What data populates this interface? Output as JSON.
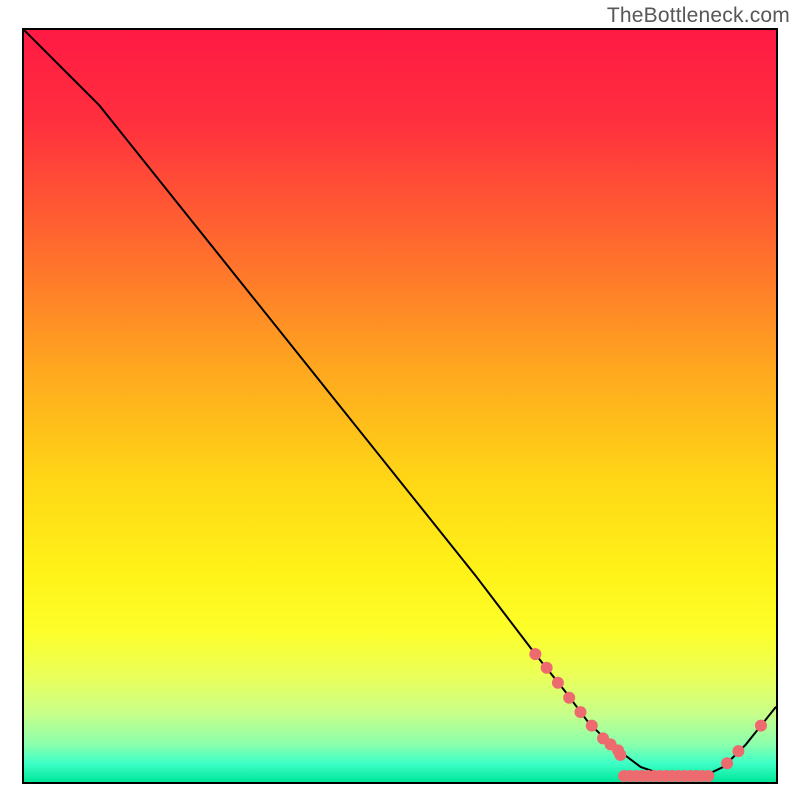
{
  "attribution": "TheBottleneck.com",
  "chart_data": {
    "type": "line",
    "title": "",
    "xlabel": "",
    "ylabel": "",
    "xlim": [
      0,
      100
    ],
    "ylim": [
      0,
      100
    ],
    "background_gradient": {
      "stops": [
        {
          "offset": 0.0,
          "color": "#ff1a44"
        },
        {
          "offset": 0.12,
          "color": "#ff2f3e"
        },
        {
          "offset": 0.3,
          "color": "#ff6f2d"
        },
        {
          "offset": 0.45,
          "color": "#ffa71f"
        },
        {
          "offset": 0.6,
          "color": "#ffd716"
        },
        {
          "offset": 0.72,
          "color": "#fff218"
        },
        {
          "offset": 0.8,
          "color": "#fdff2a"
        },
        {
          "offset": 0.86,
          "color": "#eaff5a"
        },
        {
          "offset": 0.91,
          "color": "#c7ff8a"
        },
        {
          "offset": 0.95,
          "color": "#8affac"
        },
        {
          "offset": 0.975,
          "color": "#3effc6"
        },
        {
          "offset": 1.0,
          "color": "#00e69a"
        }
      ]
    },
    "series": [
      {
        "name": "bottleneck-curve",
        "color": "#000000",
        "x": [
          0,
          6,
          10,
          20,
          30,
          40,
          50,
          60,
          68,
          72,
          75,
          78,
          82,
          86,
          90,
          93,
          96,
          100
        ],
        "y": [
          100,
          94,
          90,
          77.5,
          65,
          52.5,
          40,
          27.5,
          17,
          12,
          8,
          5,
          2,
          0.6,
          0.6,
          2,
          5,
          10
        ]
      }
    ],
    "scatter": [
      {
        "name": "markers",
        "color": "#ed6a6f",
        "radius": 6,
        "points": [
          {
            "x": 68.0,
            "y": 17.0
          },
          {
            "x": 69.5,
            "y": 15.2
          },
          {
            "x": 71.0,
            "y": 13.2
          },
          {
            "x": 72.5,
            "y": 11.2
          },
          {
            "x": 74.0,
            "y": 9.3
          },
          {
            "x": 75.5,
            "y": 7.5
          },
          {
            "x": 77.0,
            "y": 5.8
          },
          {
            "x": 78.0,
            "y": 5.0
          },
          {
            "x": 79.0,
            "y": 4.2
          },
          {
            "x": 79.3,
            "y": 3.6
          },
          {
            "x": 79.8,
            "y": 0.8
          },
          {
            "x": 80.6,
            "y": 0.8
          },
          {
            "x": 81.4,
            "y": 0.8
          },
          {
            "x": 82.2,
            "y": 0.8
          },
          {
            "x": 83.0,
            "y": 0.8
          },
          {
            "x": 83.8,
            "y": 0.8
          },
          {
            "x": 84.6,
            "y": 0.8
          },
          {
            "x": 85.4,
            "y": 0.8
          },
          {
            "x": 86.2,
            "y": 0.8
          },
          {
            "x": 87.0,
            "y": 0.8
          },
          {
            "x": 87.8,
            "y": 0.8
          },
          {
            "x": 88.6,
            "y": 0.8
          },
          {
            "x": 89.4,
            "y": 0.8
          },
          {
            "x": 90.2,
            "y": 0.8
          },
          {
            "x": 91.0,
            "y": 0.8
          },
          {
            "x": 93.5,
            "y": 2.5
          },
          {
            "x": 95.0,
            "y": 4.1
          },
          {
            "x": 98.0,
            "y": 7.5
          }
        ]
      }
    ]
  }
}
